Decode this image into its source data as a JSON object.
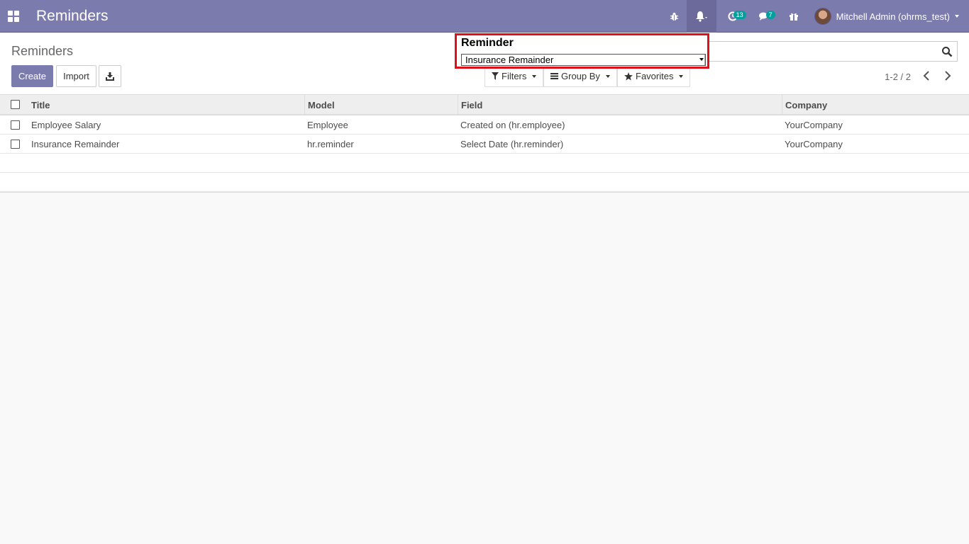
{
  "navbar": {
    "app_title": "Reminders",
    "badges": {
      "activity": "13",
      "chat": "7"
    },
    "user": "Mitchell Admin (ohrms_test)"
  },
  "control_panel": {
    "breadcrumb": "Reminders",
    "create_label": "Create",
    "import_label": "Import",
    "filters_label": "Filters",
    "groupby_label": "Group By",
    "favorites_label": "Favorites",
    "pager": "1-2 / 2"
  },
  "table": {
    "headers": [
      "Title",
      "Model",
      "Field",
      "Company"
    ],
    "rows": [
      [
        "Employee Salary",
        "Employee",
        "Created on (hr.employee)",
        "YourCompany"
      ],
      [
        "Insurance Remainder",
        "hr.reminder",
        "Select Date (hr.reminder)",
        "YourCompany"
      ]
    ]
  },
  "popup": {
    "title": "Reminder",
    "selected": "Insurance Remainder"
  },
  "colors": {
    "navbar": "#7c7bad",
    "highlight": "#e0101a",
    "badge": "#00a09d"
  }
}
